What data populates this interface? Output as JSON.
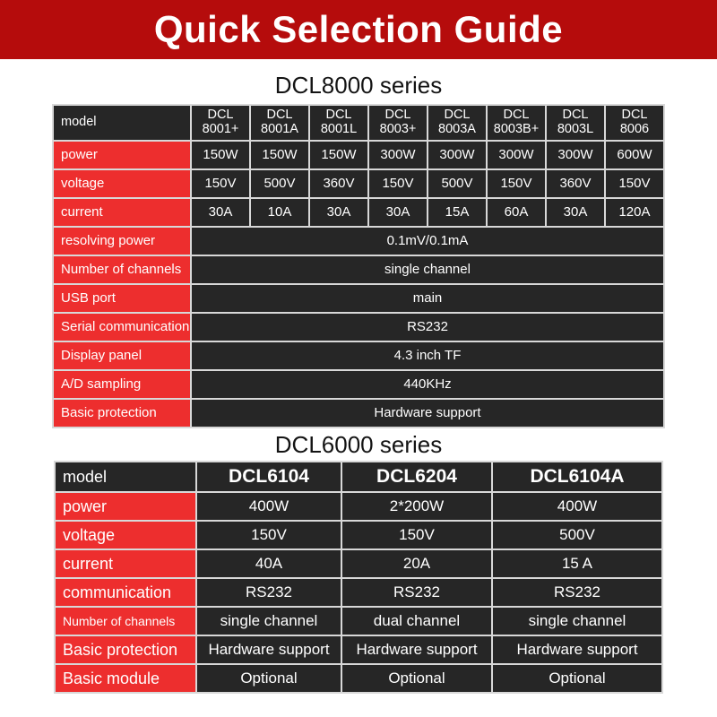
{
  "banner": {
    "title": "Quick Selection Guide",
    "bg_color": "#b50c0c",
    "text_color": "#ffffff"
  },
  "theme": {
    "label_red": "#ed2e2e",
    "cell_dark": "#262626",
    "grid_gray": "#d8d8d8"
  },
  "sections": [
    {
      "title": "DCL8000 series",
      "table": {
        "row_label_header": "model",
        "models": [
          {
            "line1": "DCL",
            "line2": "8001+"
          },
          {
            "line1": "DCL",
            "line2": "8001A"
          },
          {
            "line1": "DCL",
            "line2": "8001L"
          },
          {
            "line1": "DCL",
            "line2": "8003+"
          },
          {
            "line1": "DCL",
            "line2": "8003A"
          },
          {
            "line1": "DCL",
            "line2": "8003B+"
          },
          {
            "line1": "DCL",
            "line2": "8003L"
          },
          {
            "line1": "DCL",
            "line2": "8006"
          }
        ],
        "rows": [
          {
            "label": "power",
            "small": false,
            "values": [
              "150W",
              "150W",
              "150W",
              "300W",
              "300W",
              "300W",
              "300W",
              "600W"
            ]
          },
          {
            "label": "voltage",
            "small": false,
            "values": [
              "150V",
              "500V",
              "360V",
              "150V",
              "500V",
              "150V",
              "360V",
              "150V"
            ]
          },
          {
            "label": "current",
            "small": false,
            "values": [
              "30A",
              "10A",
              "30A",
              "30A",
              "15A",
              "60A",
              "30A",
              "120A"
            ]
          },
          {
            "label": "resolving power",
            "small": false,
            "merged": "0.1mV/0.1mA"
          },
          {
            "label": "Number of channels",
            "small": true,
            "merged": "single channel"
          },
          {
            "label": "USB port",
            "small": false,
            "merged": "main"
          },
          {
            "label": "Serial communication",
            "small": true,
            "merged": "RS232"
          },
          {
            "label": "Display panel",
            "small": false,
            "merged": "4.3 inch TF"
          },
          {
            "label": "A/D sampling",
            "small": false,
            "merged": "440KHz"
          },
          {
            "label": "Basic protection",
            "small": false,
            "merged": "Hardware support"
          }
        ]
      }
    },
    {
      "title": "DCL6000 series",
      "table": {
        "row_label_header": "model",
        "models": [
          "DCL6104",
          "DCL6204",
          "DCL6104A"
        ],
        "rows": [
          {
            "label": "power",
            "small": false,
            "values": [
              "400W",
              "2*200W",
              "400W"
            ]
          },
          {
            "label": "voltage",
            "small": false,
            "values": [
              "150V",
              "150V",
              "500V"
            ]
          },
          {
            "label": "current",
            "small": false,
            "values": [
              "40A",
              "20A",
              "15 A"
            ]
          },
          {
            "label": "communication",
            "small": false,
            "values": [
              "RS232",
              "RS232",
              "RS232"
            ]
          },
          {
            "label": "Number of channels",
            "small": true,
            "values": [
              "single channel",
              "dual channel",
              "single channel"
            ]
          },
          {
            "label": "Basic protection",
            "small": false,
            "values": [
              "Hardware support",
              "Hardware support",
              "Hardware support"
            ]
          },
          {
            "label": "Basic module",
            "small": false,
            "values": [
              "Optional",
              "Optional",
              "Optional"
            ]
          }
        ]
      }
    }
  ]
}
